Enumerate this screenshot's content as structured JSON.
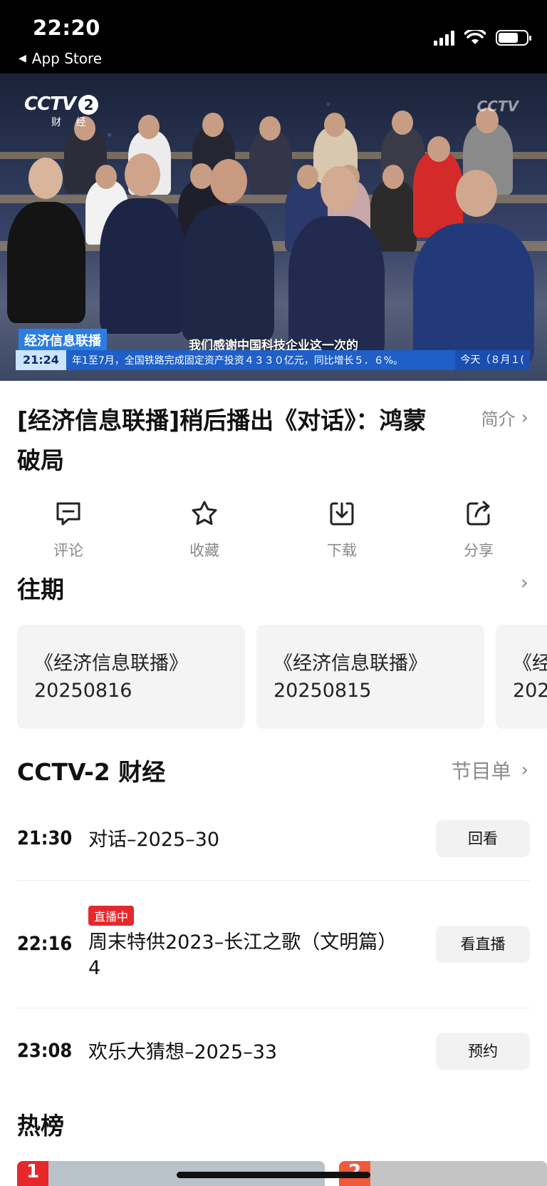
{
  "status_bar": {
    "time": "22:20",
    "back_label": "App Store",
    "icons": [
      "cellular-signal-icon",
      "wifi-icon",
      "battery-icon"
    ]
  },
  "video": {
    "channel_logo": "CCTV",
    "channel_number": "2",
    "channel_sub": "财 经",
    "watermark": "CCTV",
    "program_label": "经济信息联播",
    "subtitle": "我们感谢中国科技企业这一次的",
    "ticker_time": "21:24",
    "ticker_text": "年1至7月，全国铁路完成固定资产投资４３３０亿元，同比增长５．６%。",
    "ticker_today": "今天（８月１("
  },
  "title": "[经济信息联播]稍后播出《对话》：鸿蒙破局",
  "intro_label": "简介",
  "actions": [
    {
      "label": "评论",
      "icon": "comment-icon"
    },
    {
      "label": "收藏",
      "icon": "star-icon"
    },
    {
      "label": "下载",
      "icon": "download-icon"
    },
    {
      "label": "分享",
      "icon": "share-icon"
    }
  ],
  "past": {
    "title": "往期",
    "items": [
      {
        "name": "《经济信息联播》",
        "date": "20250816"
      },
      {
        "name": "《经济信息联播》",
        "date": "20250815"
      },
      {
        "name": "《经",
        "date": "202"
      }
    ]
  },
  "channel": {
    "title": "CCTV-2 财经",
    "schedule_label": "节目单",
    "programs": [
      {
        "time": "21:30",
        "name": "对话–2025–30",
        "button": "回看",
        "live": ""
      },
      {
        "time": "22:16",
        "name": "周末特供2023–长江之歌（文明篇）4",
        "button": "看直播",
        "live": "直播中"
      },
      {
        "time": "23:08",
        "name": "欢乐大猜想–2025–33",
        "button": "预约",
        "live": ""
      }
    ]
  },
  "hot": {
    "title": "热榜",
    "ranks": [
      "1",
      "2"
    ]
  },
  "colors": {
    "accent_red": "#e6282b",
    "ticker_blue": "#1e5fc8",
    "muted_gray": "#8a8a8a"
  }
}
